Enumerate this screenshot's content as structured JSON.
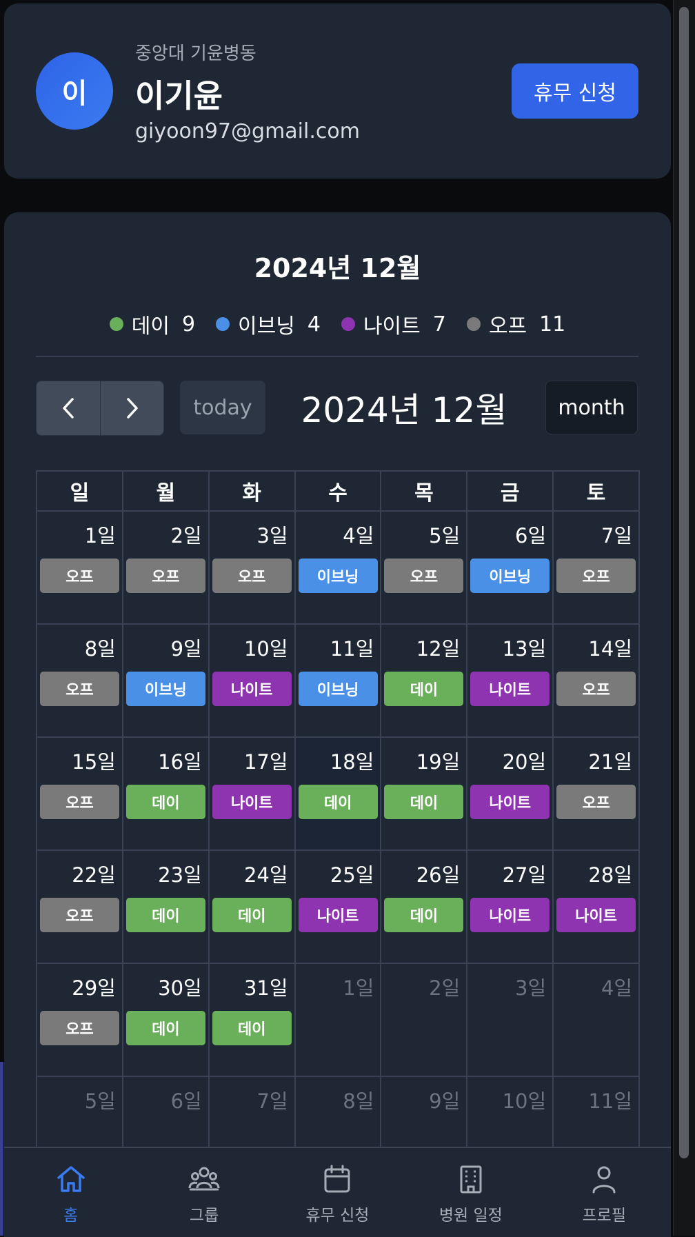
{
  "profile": {
    "avatar_letter": "이",
    "org": "중앙대 기윤병동",
    "name": "이기윤",
    "email": "giyoon97@gmail.com",
    "leave_button": "휴무 신청"
  },
  "summary": {
    "title": "2024년 12월",
    "legend": [
      {
        "label": "데이",
        "count": "9",
        "color": "#6aaf5a"
      },
      {
        "label": "이브닝",
        "count": "4",
        "color": "#4a90e6"
      },
      {
        "label": "나이트",
        "count": "7",
        "color": "#8e34b0"
      },
      {
        "label": "오프",
        "count": "11",
        "color": "#7a7a7a"
      }
    ]
  },
  "toolbar": {
    "prev_icon": "chevron-left-icon",
    "next_icon": "chevron-right-icon",
    "today_label": "today",
    "title": "2024년 12월",
    "view_label": "month"
  },
  "calendar": {
    "weekdays": [
      "일",
      "월",
      "화",
      "수",
      "목",
      "금",
      "토"
    ],
    "shift_colors": {
      "데이": "#6aaf5a",
      "이브닝": "#4a90e6",
      "나이트": "#8e34b0",
      "오프": "#7a7a7a"
    },
    "weeks": [
      [
        {
          "day": "1일",
          "shift": "오프"
        },
        {
          "day": "2일",
          "shift": "오프"
        },
        {
          "day": "3일",
          "shift": "오프"
        },
        {
          "day": "4일",
          "shift": "이브닝"
        },
        {
          "day": "5일",
          "shift": "오프"
        },
        {
          "day": "6일",
          "shift": "이브닝"
        },
        {
          "day": "7일",
          "shift": "오프"
        }
      ],
      [
        {
          "day": "8일",
          "shift": "오프"
        },
        {
          "day": "9일",
          "shift": "이브닝"
        },
        {
          "day": "10일",
          "shift": "나이트"
        },
        {
          "day": "11일",
          "shift": "이브닝"
        },
        {
          "day": "12일",
          "shift": "데이"
        },
        {
          "day": "13일",
          "shift": "나이트"
        },
        {
          "day": "14일",
          "shift": "오프"
        }
      ],
      [
        {
          "day": "15일",
          "shift": "오프"
        },
        {
          "day": "16일",
          "shift": "데이"
        },
        {
          "day": "17일",
          "shift": "나이트"
        },
        {
          "day": "18일",
          "shift": "데이",
          "today": true
        },
        {
          "day": "19일",
          "shift": "데이"
        },
        {
          "day": "20일",
          "shift": "나이트"
        },
        {
          "day": "21일",
          "shift": "오프"
        }
      ],
      [
        {
          "day": "22일",
          "shift": "오프"
        },
        {
          "day": "23일",
          "shift": "데이"
        },
        {
          "day": "24일",
          "shift": "데이"
        },
        {
          "day": "25일",
          "shift": "나이트"
        },
        {
          "day": "26일",
          "shift": "데이"
        },
        {
          "day": "27일",
          "shift": "나이트"
        },
        {
          "day": "28일",
          "shift": "나이트"
        }
      ],
      [
        {
          "day": "29일",
          "shift": "오프"
        },
        {
          "day": "30일",
          "shift": "데이"
        },
        {
          "day": "31일",
          "shift": "데이"
        },
        {
          "day": "1일",
          "other": true
        },
        {
          "day": "2일",
          "other": true
        },
        {
          "day": "3일",
          "other": true
        },
        {
          "day": "4일",
          "other": true
        }
      ],
      [
        {
          "day": "5일",
          "other": true
        },
        {
          "day": "6일",
          "other": true
        },
        {
          "day": "7일",
          "other": true
        },
        {
          "day": "8일",
          "other": true
        },
        {
          "day": "9일",
          "other": true
        },
        {
          "day": "10일",
          "other": true
        },
        {
          "day": "11일",
          "other": true
        }
      ]
    ]
  },
  "bottom_nav": [
    {
      "label": "홈",
      "icon": "home-icon",
      "active": true
    },
    {
      "label": "그룹",
      "icon": "group-icon"
    },
    {
      "label": "휴무 신청",
      "icon": "calendar-icon"
    },
    {
      "label": "병원 일정",
      "icon": "hospital-building-icon"
    },
    {
      "label": "프로필",
      "icon": "user-icon"
    }
  ]
}
